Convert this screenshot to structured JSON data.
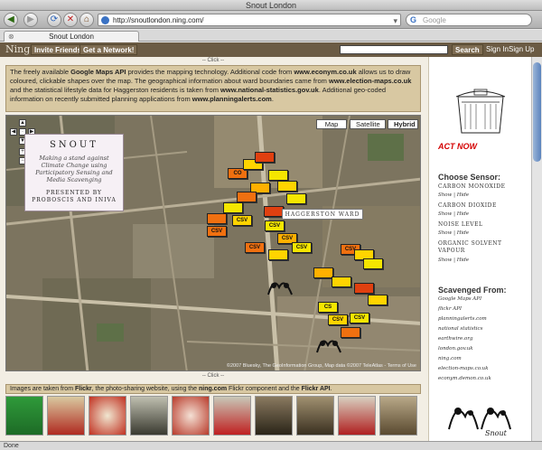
{
  "window": {
    "title": "Snout London"
  },
  "toolbar": {
    "back": "◀",
    "forward": "▶",
    "reload": "⟳",
    "stop": "✕",
    "home": "⌂",
    "url": "http://snoutlondon.ning.com/",
    "search_placeholder": "Google"
  },
  "tab": {
    "title": "Snout London"
  },
  "ning": {
    "logo": "Ning",
    "invite": "Invite Friends",
    "get_network": "Get a Network!",
    "search_button": "Search",
    "sign_in": "Sign In",
    "sign_up": "Sign Up"
  },
  "main": {
    "click_top": "-- Click --",
    "click_bottom": "-- Click --",
    "info": {
      "t1": "The freely available ",
      "b1": "Google Maps API",
      "t2": " provides the mapping technology. Additional code from ",
      "b2": "www.econym.co.uk",
      "t3": " allows us to draw coloured, clickable shapes over the map. The geographical information about ward boundaries came from ",
      "b3": "www.election-maps.co.uk",
      "t4": " and the statistical lifestyle data for Haggerston residents is taken from ",
      "b4": "www.national-statistics.gov.uk",
      "t5": ". Additional geo-coded information on recently submitted planning applications from ",
      "b5": "www.planningalerts.com",
      "t6": "."
    },
    "map": {
      "types": [
        "Map",
        "Satellite",
        "Hybrid"
      ],
      "snout_title": "SNOUT",
      "snout_tagline": "Making a stand against Climate Change using Participatory Sensing and Media Scavenging",
      "snout_by": "PRESENTED BY PROBOSCIS AND INIVA",
      "ward_label": "HAGGERSTON WARD",
      "csv_label": "CSV",
      "co_label": "CO",
      "cs_label": "CS",
      "footer": "©2007 Bluesky, The GeoInformation Group, Map data ©2007 TeleAtlas - Terms of Use"
    },
    "images_caption": {
      "t1": "Images are taken from ",
      "b1": "Flickr",
      "t2": ", the photo-sharing website, using the ",
      "b2": "ning.com",
      "t3": " Flickr component and the ",
      "b3": "Flickr API",
      "t4": "."
    }
  },
  "sidebar": {
    "act_now": "ACT NOW",
    "choose_sensor": "Choose Sensor:",
    "sensors": [
      {
        "name": "CARBON MONOXIDE",
        "show": "Show",
        "hide": "Hide"
      },
      {
        "name": "CARBON DIOXIDE",
        "show": "Show",
        "hide": "Hide"
      },
      {
        "name": "NOISE LEVEL",
        "show": "Show",
        "hide": "Hide"
      },
      {
        "name": "ORGANIC SOLVENT VAPOUR",
        "show": "Show",
        "hide": "Hide"
      }
    ],
    "scavenged_title": "Scavenged From:",
    "scavenged": [
      "Google Maps API",
      "flickr API",
      "planningalerts.com",
      "national statistics",
      "earthwire.org",
      "london.gov.uk",
      "ning.com",
      "election-maps.co.uk",
      "econym.demon.co.uk"
    ],
    "logo_text": "Snout"
  },
  "status": {
    "text": "Done"
  }
}
